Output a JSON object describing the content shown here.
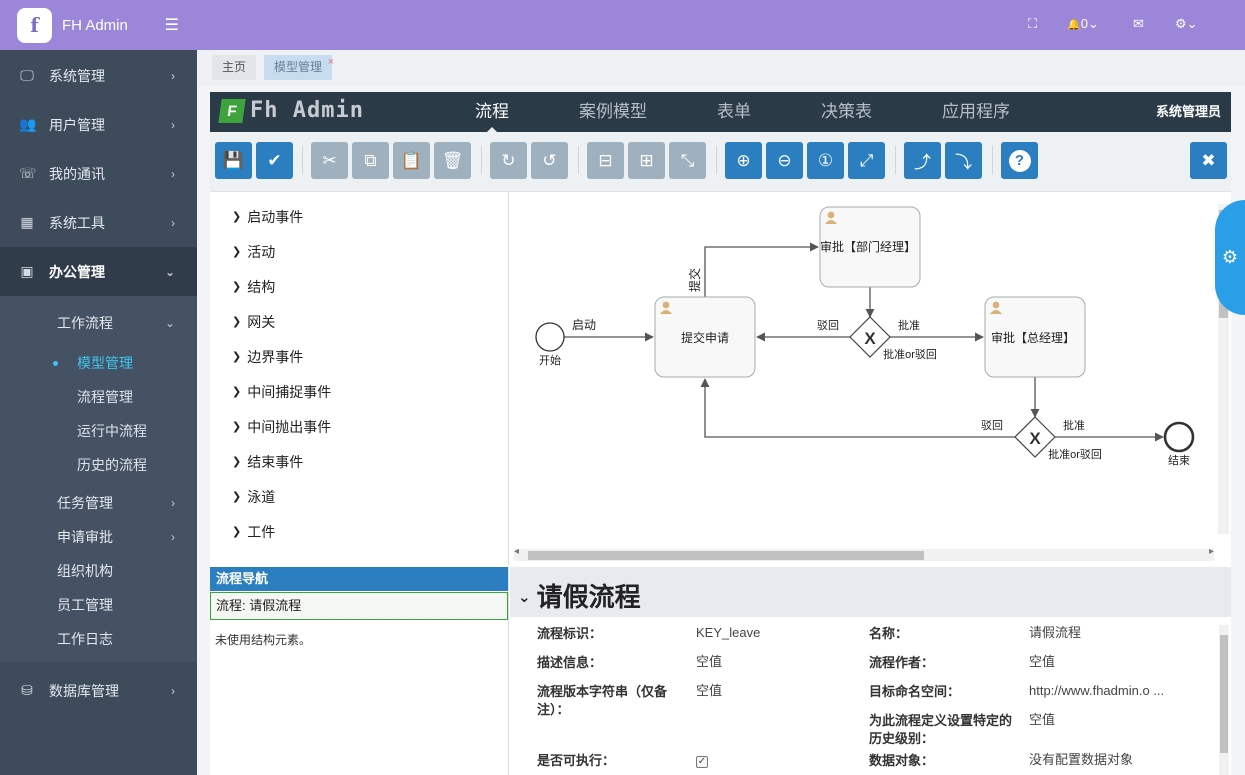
{
  "sidebar": {
    "brand_logo": "f",
    "brand_name": "FH Admin",
    "toggle_icon": "☰",
    "items": [
      {
        "label": "系统管理",
        "icon": "🖵",
        "icon_name": "monitor-icon"
      },
      {
        "label": "用户管理",
        "icon": "👥",
        "icon_name": "users-icon"
      },
      {
        "label": "我的通讯",
        "icon": "☏",
        "icon_name": "phone-icon"
      },
      {
        "label": "系统工具",
        "icon": "▦",
        "icon_name": "grid-icon"
      },
      {
        "label": "办公管理",
        "icon": "▣",
        "icon_name": "briefcase-icon"
      },
      {
        "label": "数据库管理",
        "icon": "⛁",
        "icon_name": "database-icon"
      }
    ],
    "office_sub": {
      "workflow": "工作流程",
      "workflow_items": [
        "模型管理",
        "流程管理",
        "运行中流程",
        "历史的流程"
      ],
      "others": [
        "任务管理",
        "申请审批",
        "组织机构",
        "员工管理",
        "工作日志"
      ]
    },
    "chevron_right": "›",
    "chevron_down": "⌄"
  },
  "topbar": {
    "fullscreen_icon": "⛶",
    "bell_icon": "🔔",
    "bell_count": "0",
    "mail_icon": "✉",
    "gear_icon": "⚙",
    "dropdown_icon": "⌄"
  },
  "tabs": [
    {
      "label": "主页"
    },
    {
      "label": "模型管理",
      "close": "×"
    }
  ],
  "editor": {
    "logo_mark": "F",
    "logo_text": "Fh Admin",
    "nav": [
      "流程",
      "案例模型",
      "表单",
      "决策表",
      "应用程序"
    ],
    "user": "系统管理员",
    "toolbar_icons": {
      "save": "💾",
      "check": "✔",
      "cut": "✂",
      "copy": "⧉",
      "paste": "📋",
      "delete": "🗑",
      "redo": "↻",
      "undo": "↺",
      "align_h": "⊟",
      "align_v": "⊞",
      "connect": "⤡",
      "zoom_in": "⊕",
      "zoom_out": "⊖",
      "zoom_actual": "①",
      "zoom_fit": "⤢",
      "bend_add": "⤴",
      "bend_remove": "⤵",
      "help": "?",
      "close": "✖"
    },
    "palette": [
      "启动事件",
      "活动",
      "结构",
      "网关",
      "边界事件",
      "中间捕捉事件",
      "中间抛出事件",
      "结束事件",
      "泳道",
      "工件"
    ],
    "palette_arrow": "❯",
    "diagram": {
      "start_label": "开始",
      "start_flow": "启动",
      "task_submit": "提交申请",
      "submit_flow": "提交",
      "task_dept": "审批【部门经理】",
      "task_gm": "审批【总经理】",
      "gateway_label": "批准or驳回",
      "gateway_mark": "X",
      "reject": "驳回",
      "approve": "批准",
      "end_label": "结束"
    },
    "nav_panel": {
      "title": "流程导航",
      "row": "流程: 请假流程",
      "note": "未使用结构元素。"
    },
    "props": {
      "caret": "⌄",
      "title": "请假流程",
      "fields": {
        "id_label": "流程标识：",
        "id_value": "KEY_leave",
        "name_label": "名称：",
        "name_value": "请假流程",
        "desc_label": "描述信息：",
        "desc_value": "空值",
        "author_label": "流程作者：",
        "author_value": "空值",
        "version_label": "流程版本字符串（仅备注）：",
        "version_value": "空值",
        "ns_label": "目标命名空间：",
        "ns_value": "http://www.fhadmin.o ...",
        "history_label": "为此流程定义设置特定的历史级别：",
        "history_value": "空值",
        "exec_label": "是否可执行：",
        "exec_value": "✓",
        "data_label": "数据对象：",
        "data_value": "没有配置数据对象"
      }
    },
    "scroll_up": "▴",
    "scroll_down": "▾",
    "scroll_left": "◂",
    "scroll_right": "▸"
  },
  "settings_tab_icon": "⚙"
}
